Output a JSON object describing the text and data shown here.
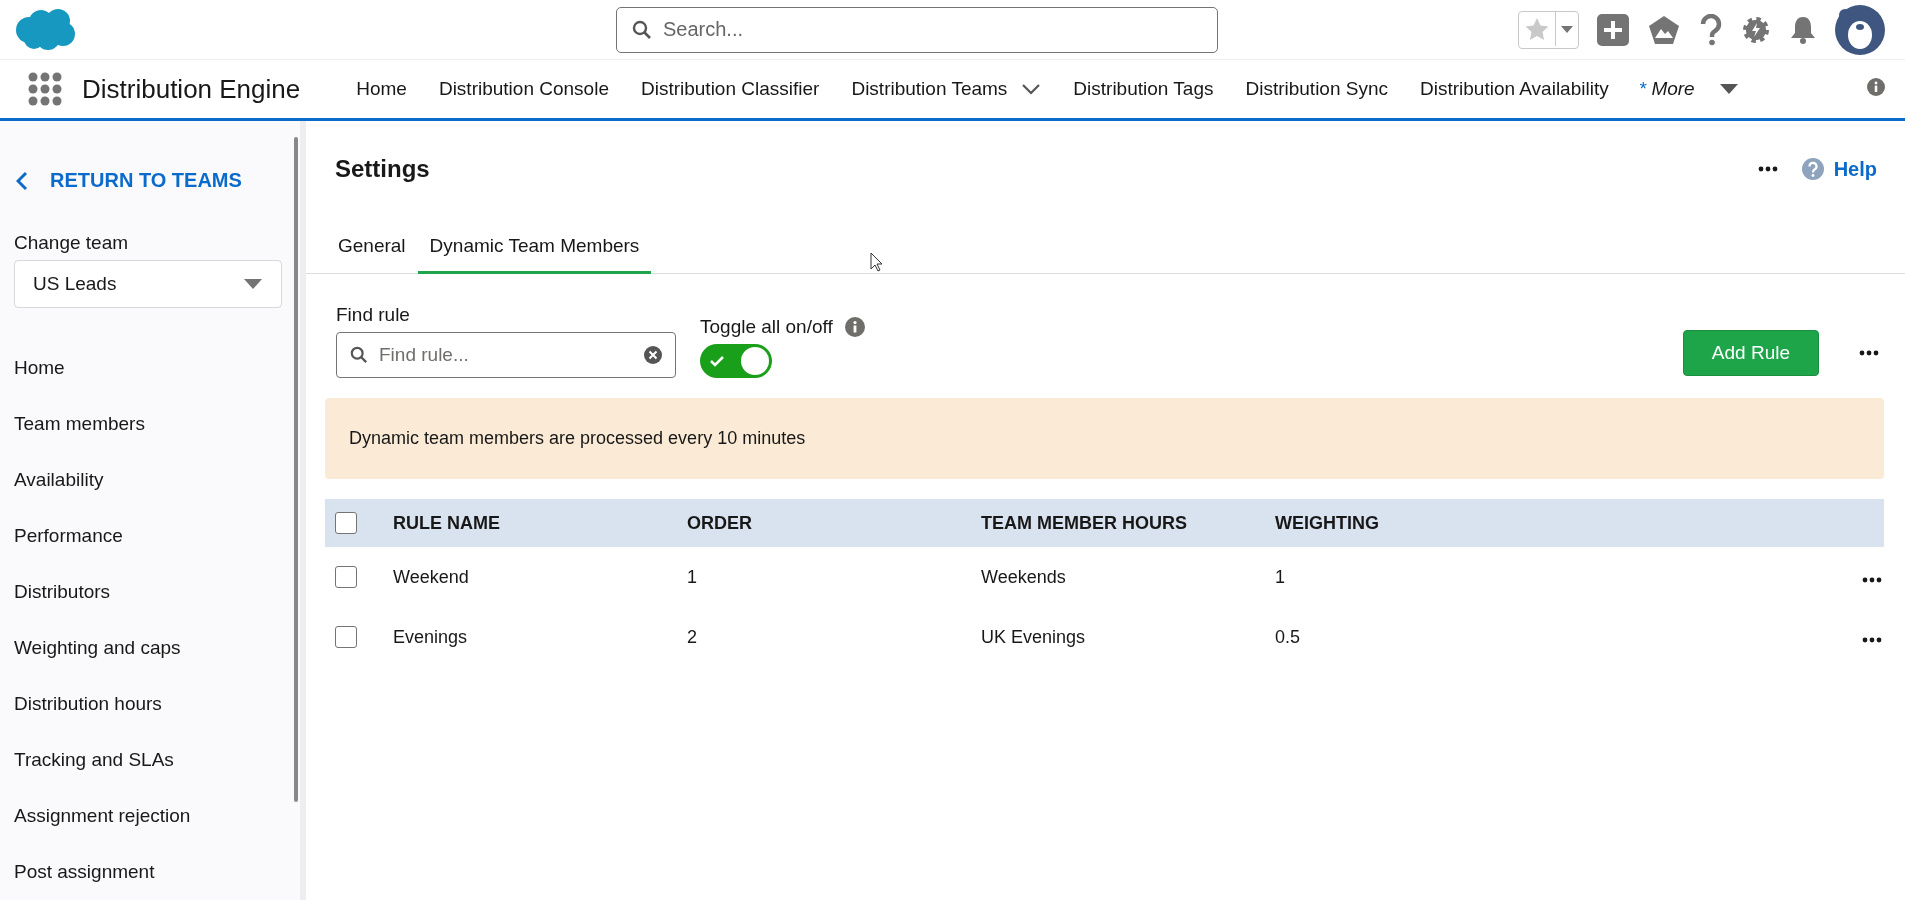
{
  "header": {
    "search_placeholder": "Search..."
  },
  "nav": {
    "app_name": "Distribution Engine",
    "items": [
      {
        "label": "Home",
        "kind": "link"
      },
      {
        "label": "Distribution Console",
        "kind": "link"
      },
      {
        "label": "Distribution Classifier",
        "kind": "link"
      },
      {
        "label": "Distribution Teams",
        "kind": "dropdown"
      },
      {
        "label": "Distribution Tags",
        "kind": "link"
      },
      {
        "label": "Distribution Sync",
        "kind": "link"
      },
      {
        "label": "Distribution Availability",
        "kind": "link"
      }
    ],
    "more_label": "* More"
  },
  "sidebar": {
    "back_link": "RETURN TO TEAMS",
    "team_label": "Change team",
    "team_value": "US Leads",
    "items": [
      "Home",
      "Team members",
      "Availability",
      "Performance",
      "Distributors",
      "Weighting and caps",
      "Distribution hours",
      "Tracking and SLAs",
      "Assignment rejection",
      "Post assignment"
    ]
  },
  "page": {
    "title": "Settings",
    "help": "Help",
    "tabs": [
      {
        "label": "General",
        "selected": false
      },
      {
        "label": "Dynamic Team Members",
        "selected": true
      }
    ],
    "find_rule": {
      "label": "Find rule",
      "placeholder": "Find rule..."
    },
    "toggle": {
      "label": "Toggle all on/off",
      "on": true
    },
    "add_button": "Add Rule",
    "banner": "Dynamic team members are processed every 10 minutes",
    "table": {
      "select_all": false,
      "columns": [
        "RULE NAME",
        "ORDER",
        "TEAM MEMBER HOURS",
        "WEIGHTING"
      ],
      "rows": [
        {
          "selected": false,
          "cells": [
            "Weekend",
            "1",
            "Weekends",
            "1"
          ]
        },
        {
          "selected": false,
          "cells": [
            "Evenings",
            "2",
            "UK Evenings",
            "0.5"
          ]
        }
      ]
    }
  }
}
